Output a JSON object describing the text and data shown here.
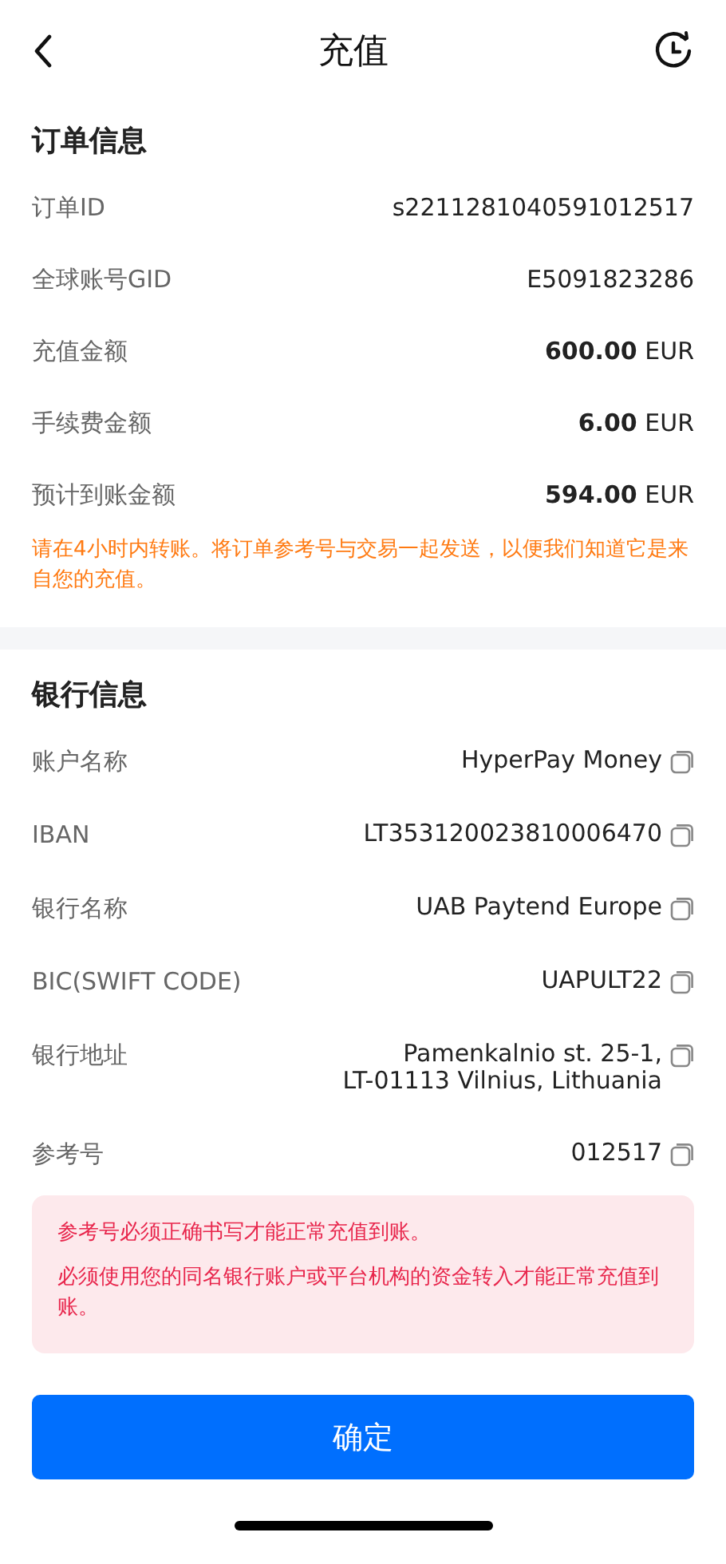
{
  "header": {
    "title": "充值"
  },
  "order": {
    "title": "订单信息",
    "rows": [
      {
        "label": "订单ID",
        "value": "s2211281040591012517"
      },
      {
        "label": "全球账号GID",
        "value": "E5091823286"
      },
      {
        "label": "充值金额",
        "value": "**600.00** EUR"
      },
      {
        "label": "手续费金额",
        "value": "**6.00** EUR"
      },
      {
        "label": "预计到账金额",
        "value": "**594.00** EUR"
      }
    ],
    "note": "请在4小时内转账。将订单参考号与交易一起发送，以便我们知道它是来自您的充值。"
  },
  "bank": {
    "title": "银行信息",
    "rows": [
      {
        "label": "账户名称",
        "lines": [
          "HyperPay Money"
        ]
      },
      {
        "label": "IBAN",
        "lines": [
          "LT353120023810006470"
        ]
      },
      {
        "label": "银行名称",
        "lines": [
          "UAB Paytend Europe"
        ]
      },
      {
        "label": "BIC(SWIFT CODE)",
        "lines": [
          "UAPULT22"
        ]
      },
      {
        "label": "银行地址",
        "lines": [
          "Pamenkalnio st. 25-1,",
          "LT-01113 Vilnius, Lithuania"
        ]
      },
      {
        "label": "参考号",
        "lines": [
          "012517"
        ]
      }
    ],
    "warnings": [
      "参考号必须正确书写才能正常充值到账。",
      "必须使用您的同名银行账户或平台机构的资金转入才能正常充值到账。"
    ]
  },
  "confirm_button": "确定"
}
